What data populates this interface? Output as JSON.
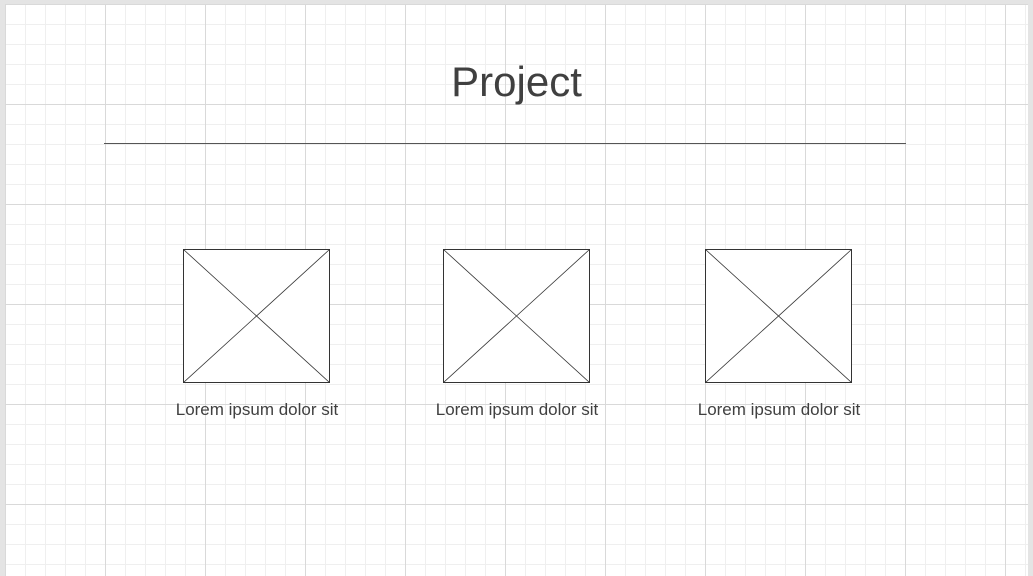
{
  "title": "Project",
  "cards": [
    {
      "caption": "Lorem ipsum dolor sit"
    },
    {
      "caption": "Lorem ipsum dolor sit"
    },
    {
      "caption": "Lorem ipsum dolor sit"
    }
  ],
  "colors": {
    "background": "#ffffff",
    "grid_minor": "#efefef",
    "grid_major": "#d9d9d9",
    "text": "#404040",
    "stroke": "#333333"
  }
}
